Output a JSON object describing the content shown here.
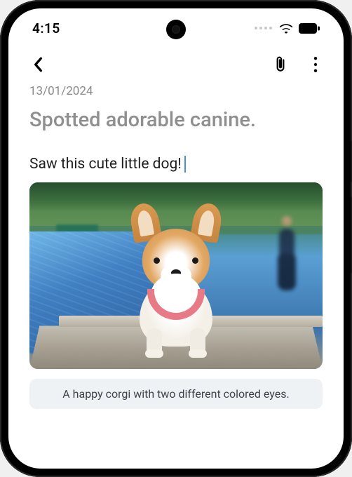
{
  "status_bar": {
    "time": "4:15"
  },
  "app_bar": {
    "back_icon": "chevron-left",
    "attach_icon": "paperclip",
    "more_icon": "more-vert"
  },
  "note": {
    "date": "13/01/2024",
    "title": "Spotted adorable canine.",
    "body": "Saw this cute little dog!",
    "image_alt": "corgi photo",
    "caption": "A happy corgi with two different colored eyes."
  }
}
